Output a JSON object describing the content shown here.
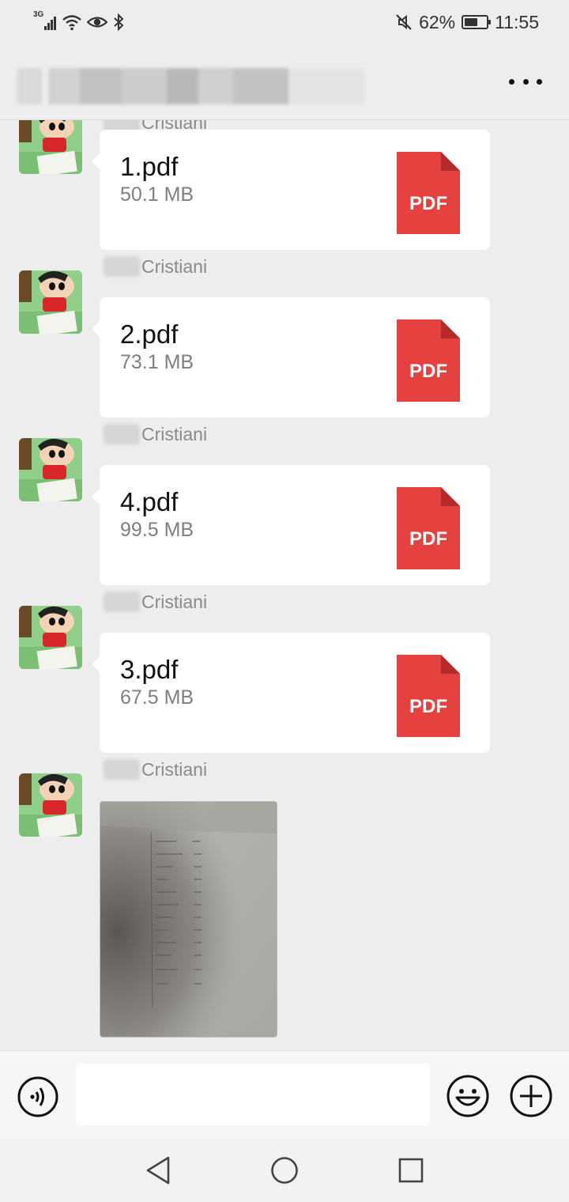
{
  "status_bar": {
    "network_label": "3G",
    "battery_percent_text": "62%",
    "battery_level": 0.62,
    "time": "11:55",
    "icons": [
      "signal-icon",
      "wifi-icon",
      "eye-icon",
      "bluetooth-icon",
      "mute-icon",
      "battery-icon"
    ]
  },
  "header": {
    "title_redacted": true,
    "more_icon": "more-horizontal-icon"
  },
  "messages": [
    {
      "sender": "Cristiani",
      "type": "file",
      "file_name": "1.pdf",
      "file_size": "50.1 MB",
      "file_badge": "PDF"
    },
    {
      "sender": "Cristiani",
      "type": "file",
      "file_name": "2.pdf",
      "file_size": "73.1 MB",
      "file_badge": "PDF"
    },
    {
      "sender": "Cristiani",
      "type": "file",
      "file_name": "4.pdf",
      "file_size": "99.5 MB",
      "file_badge": "PDF"
    },
    {
      "sender": "Cristiani",
      "type": "file",
      "file_name": "3.pdf",
      "file_size": "67.5 MB",
      "file_badge": "PDF"
    },
    {
      "sender": "Cristiani",
      "type": "image"
    }
  ],
  "input_bar": {
    "placeholder": "",
    "icons": [
      "voice-icon",
      "emoji-icon",
      "plus-icon"
    ]
  },
  "nav_bar": {
    "icons": [
      "back-icon",
      "home-icon",
      "recent-apps-icon"
    ]
  },
  "colors": {
    "background": "#ededed",
    "bubble": "#ffffff",
    "pdf_red": "#e5413e",
    "text_primary": "#111111",
    "text_secondary": "#7f7f7f"
  }
}
